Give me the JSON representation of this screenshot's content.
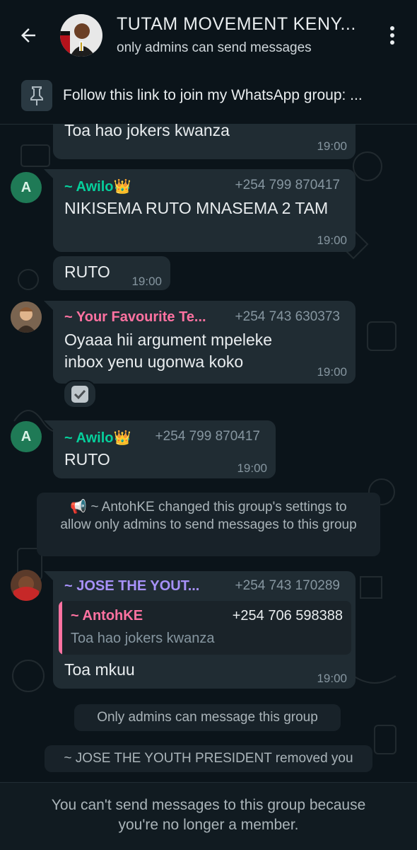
{
  "header": {
    "title": "TUTAM MOVEMENT KENY...",
    "subtitle": "only admins can send messages",
    "back_icon": "arrow-left-icon",
    "menu_icon": "kebab-menu-icon"
  },
  "pinned": {
    "text": "Follow this link to join my WhatsApp group: ...",
    "icon": "pin-icon"
  },
  "messages": {
    "m1": {
      "text": "Toa hao jokers kwanza",
      "time": "19:00"
    },
    "m2": {
      "avatar_letter": "A",
      "sender": "~ Awilo👑",
      "phone": "+254 799 870417",
      "text": "NIKISEMA RUTO MNASEMA 2 TAM",
      "time": "19:00"
    },
    "m3": {
      "text": "RUTO",
      "time": "19:00"
    },
    "m4": {
      "sender": "~ Your Favourite Te...",
      "phone": "+254 743 630373",
      "text": "Oyaaa hii argument mpeleke inbox yenu ugonwa koko",
      "time": "19:00"
    },
    "m5": {
      "avatar_letter": "A",
      "sender": "~ Awilo👑",
      "phone": "+254 799 870417",
      "text": "RUTO",
      "time": "19:00"
    },
    "sys1": {
      "text": "📢 ~ AntohKE changed this group's settings to allow only admins to send messages to this group"
    },
    "m6": {
      "sender": "~ JOSE THE YOUT...",
      "phone": "+254 743 170289",
      "quote_sender": "~ AntohKE",
      "quote_phone": "+254 706 598388",
      "quote_text": "Toa hao jokers kwanza",
      "text": "Toa mkuu",
      "time": "19:00"
    },
    "sys2": {
      "text": "Only admins can message this group"
    },
    "sys3": {
      "text": "~ JOSE THE YOUTH PRESIDENT removed you"
    }
  },
  "footer": {
    "line1": "You can't send messages to this group because",
    "line2": "you're no longer a member."
  },
  "colors": {
    "background": "#0b141a",
    "bubble": "#202c33",
    "sender_green": "#53bdeb",
    "awilo_green": "#06cf9c",
    "pink": "#ff72a1",
    "purple": "#a791f9"
  }
}
